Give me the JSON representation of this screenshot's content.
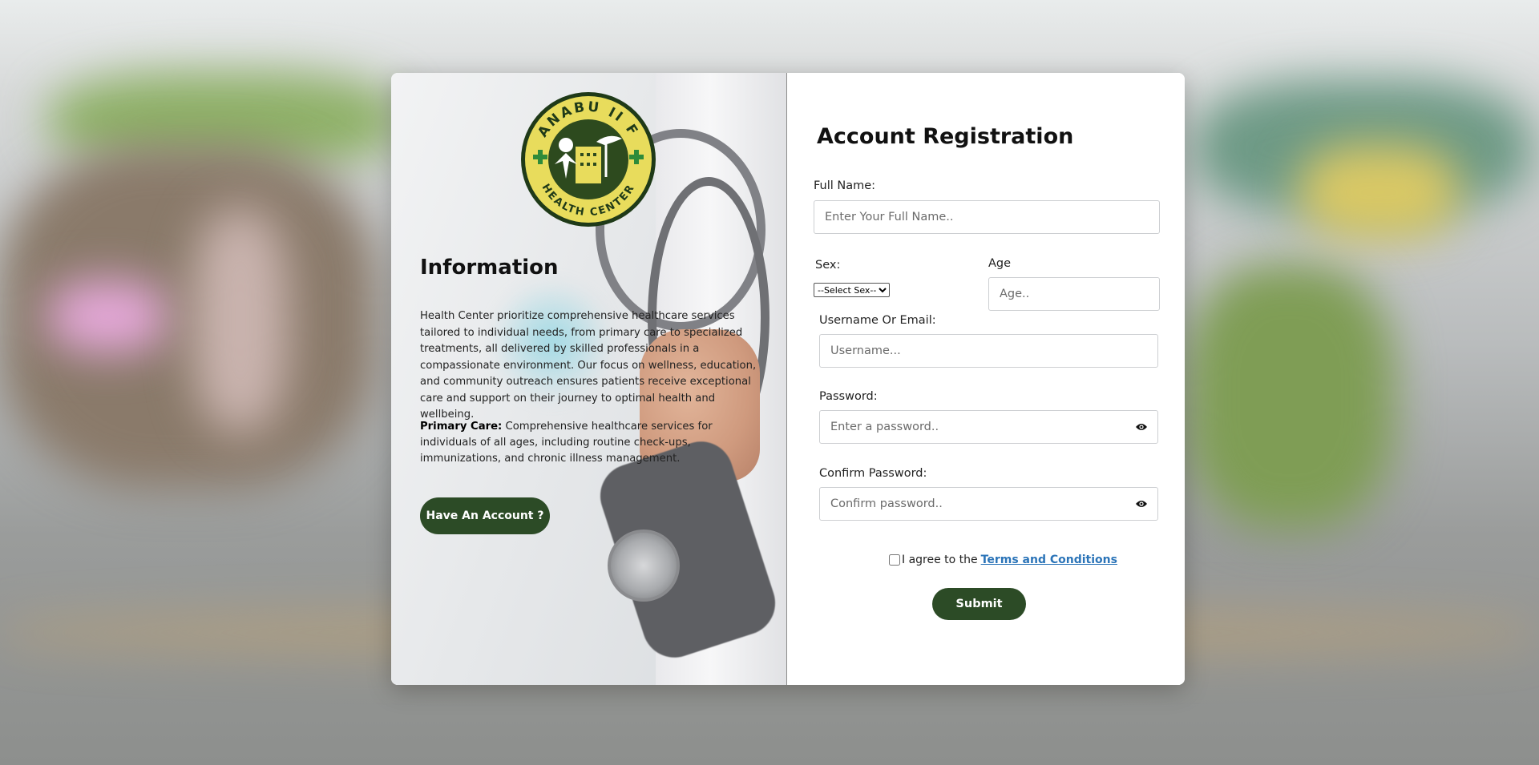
{
  "logo": {
    "top_text": "ANABU II F",
    "bottom_text": "HEALTH CENTER",
    "colors": {
      "ring": "#2d4a1e",
      "fill": "#e8dc5c",
      "accent": "#2e8b3a"
    }
  },
  "info": {
    "title": "Information",
    "paragraph": "Health Center prioritize comprehensive healthcare services tailored to individual needs, from primary care to specialized treatments, all delivered by skilled professionals in a compassionate environment. Our focus on wellness, education, and community outreach ensures patients receive exceptional care and support on their journey to optimal health and wellbeing.",
    "primary_label": "Primary Care:",
    "primary_text": " Comprehensive healthcare services for individuals of all ages, including routine check-ups, immunizations, and chronic illness management.",
    "have_account_button": "Have An Account ?"
  },
  "form": {
    "title": "Account Registration",
    "full_name": {
      "label": "Full Name:",
      "placeholder": "Enter Your Full Name.."
    },
    "sex": {
      "label": "Sex:",
      "selected": "--Select Sex--"
    },
    "age": {
      "label": "Age",
      "placeholder": "Age.."
    },
    "username": {
      "label": "Username Or Email:",
      "placeholder": "Username..."
    },
    "password": {
      "label": "Password:",
      "placeholder": "Enter a password.."
    },
    "confirm_password": {
      "label": "Confirm Password:",
      "placeholder": "Confirm password.."
    },
    "agree_text": "I agree to the",
    "terms_link": "Terms and Conditions",
    "submit": "Submit"
  },
  "icons": {
    "password_toggle": "eye-icon",
    "confirm_toggle": "eye-icon"
  },
  "colors": {
    "brand_green": "#2c4b26",
    "link": "#2b74b8"
  }
}
